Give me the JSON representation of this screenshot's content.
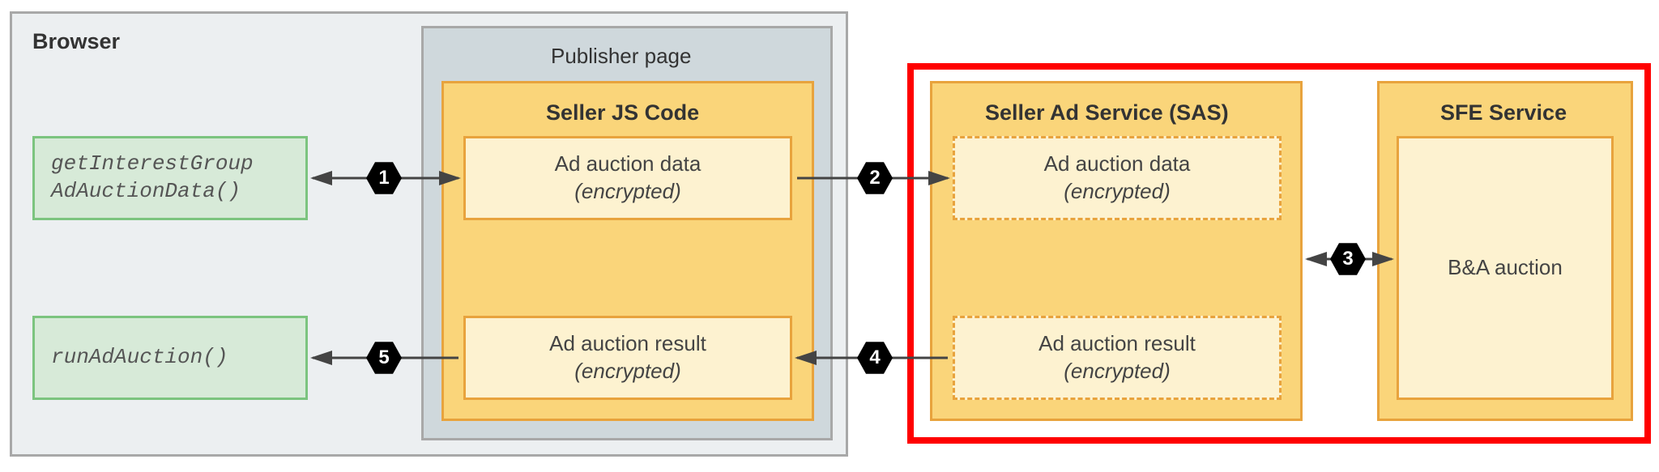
{
  "browser": {
    "label": "Browser",
    "publisher_label": "Publisher page",
    "api1": "getInterestGroup\nAdAuctionData()",
    "api2": "runAdAuction()",
    "seller_js": {
      "title": "Seller JS Code",
      "data_line1": "Ad auction data",
      "data_line2": "(encrypted)",
      "result_line1": "Ad auction result",
      "result_line2": "(encrypted)"
    }
  },
  "sas": {
    "title": "Seller Ad Service (SAS)",
    "data_line1": "Ad auction data",
    "data_line2": "(encrypted)",
    "result_line1": "Ad auction result",
    "result_line2": "(encrypted)"
  },
  "sfe": {
    "title": "SFE Service",
    "body": "B&A auction"
  },
  "steps": {
    "s1": "1",
    "s2": "2",
    "s3": "3",
    "s4": "4",
    "s5": "5"
  }
}
